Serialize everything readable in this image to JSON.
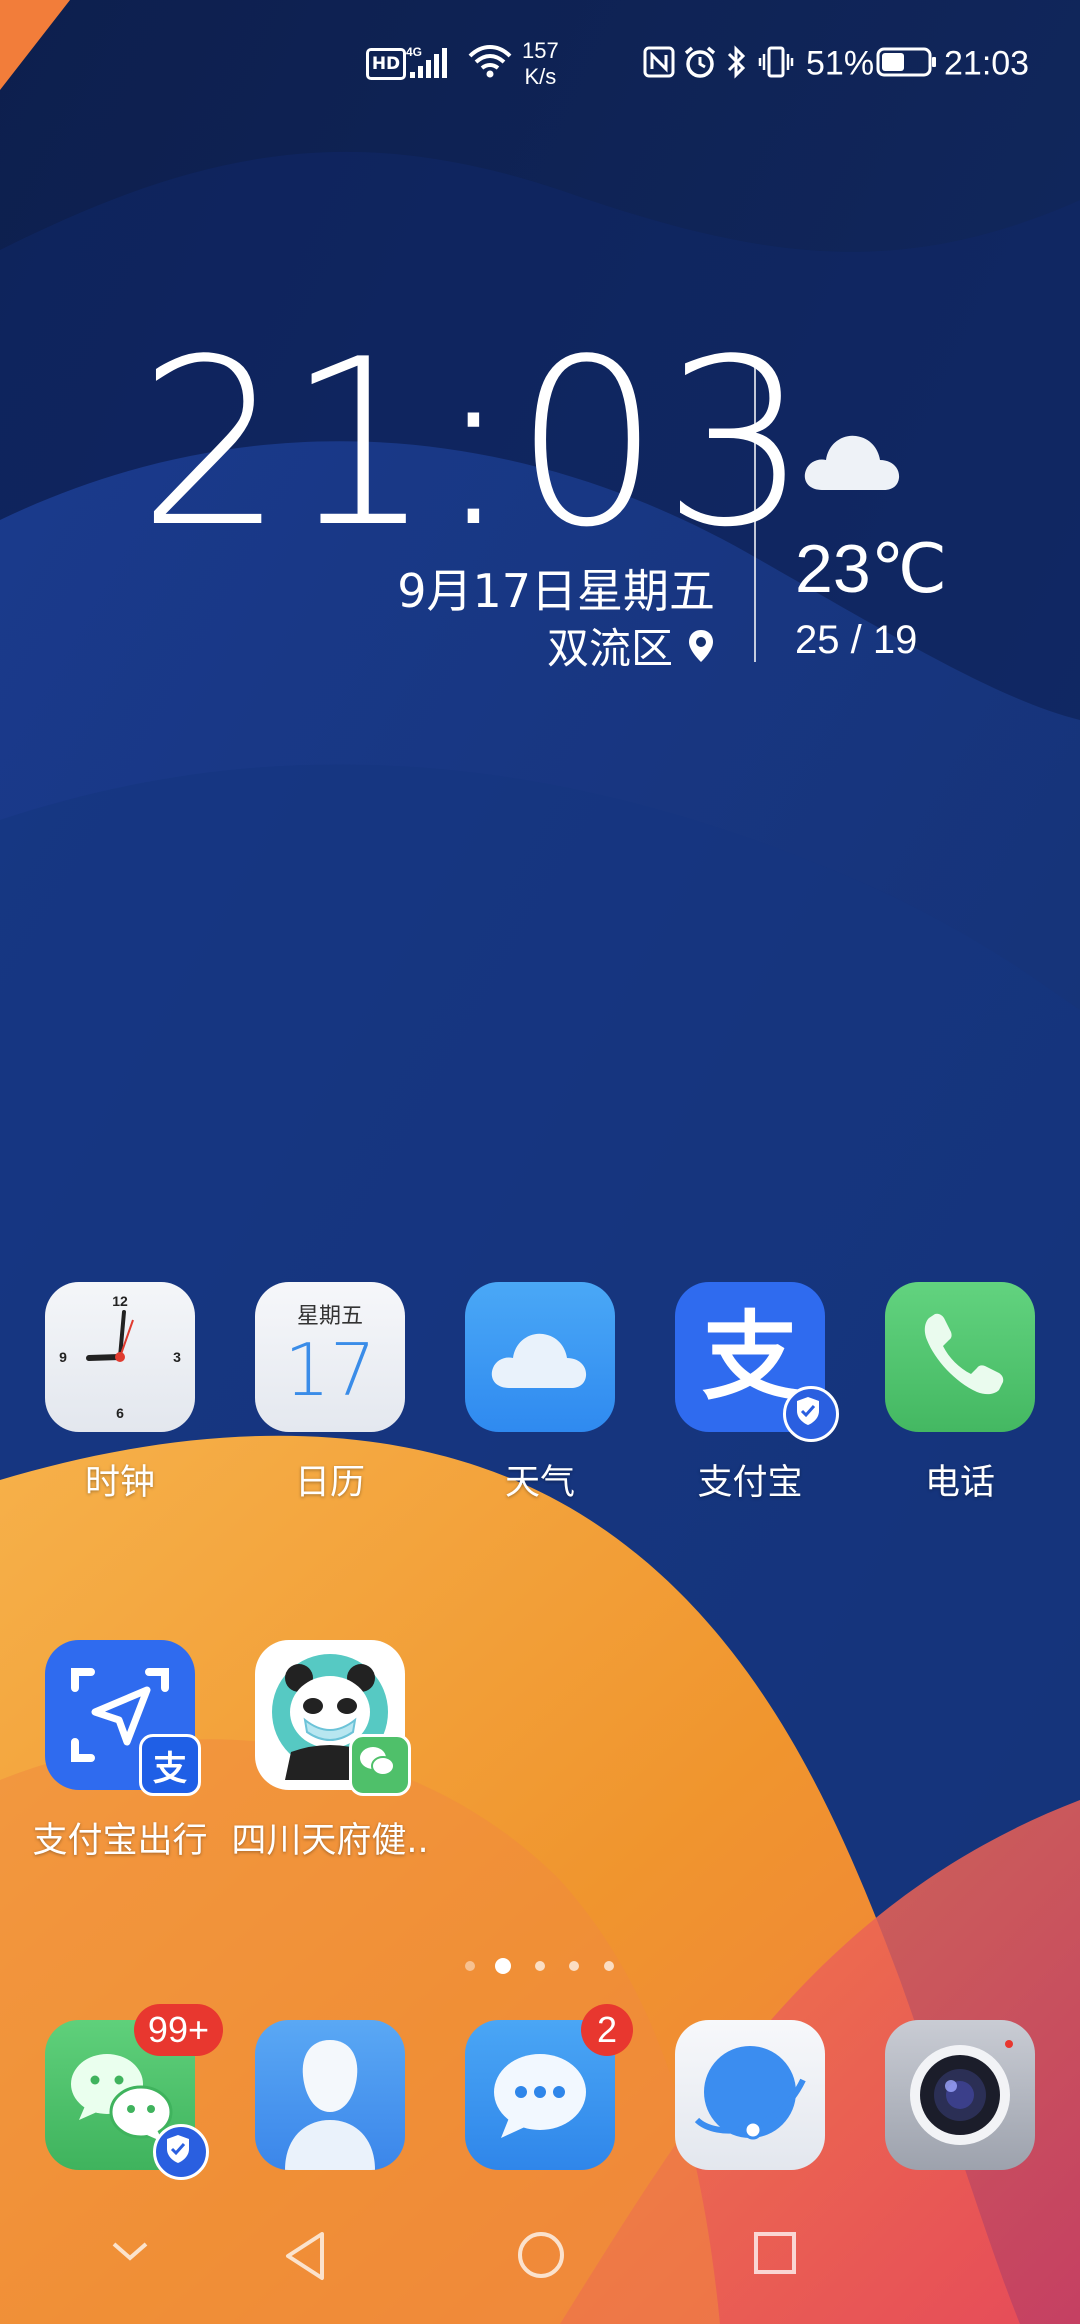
{
  "status_bar": {
    "hd_label": "HD",
    "network_label": "4G",
    "speed_value": "157",
    "speed_unit": "K/s",
    "battery_percent": "51%",
    "time": "21:03",
    "battery_level": 0.51,
    "icons": [
      "nfc-icon",
      "alarm-icon",
      "bluetooth-icon",
      "vibrate-icon",
      "battery-icon"
    ]
  },
  "clock_widget": {
    "time": "21:03",
    "date": "9月17日星期五",
    "location": "双流区",
    "weather_icon": "cloud-icon",
    "temperature": "23℃",
    "temp_range": "25 / 19"
  },
  "apps_row1": [
    {
      "label": "时钟",
      "icon": "clock-icon"
    },
    {
      "label": "日历",
      "icon": "calendar-icon",
      "weekday": "星期五",
      "day": "17"
    },
    {
      "label": "天气",
      "icon": "weather-icon"
    },
    {
      "label": "支付宝",
      "icon": "alipay-icon",
      "glyph": "支"
    },
    {
      "label": "电话",
      "icon": "phone-icon"
    }
  ],
  "apps_row2": [
    {
      "label": "支付宝出行",
      "icon": "alipay-travel-icon",
      "glyph": "支"
    },
    {
      "label": "四川天府健..",
      "icon": "tianfu-health-icon"
    }
  ],
  "dock": [
    {
      "name": "wechat",
      "icon": "wechat-icon",
      "badge": "99+"
    },
    {
      "name": "contacts",
      "icon": "contacts-icon"
    },
    {
      "name": "messages",
      "icon": "messages-icon",
      "badge": "2"
    },
    {
      "name": "browser",
      "icon": "browser-icon"
    },
    {
      "name": "camera",
      "icon": "camera-icon"
    }
  ],
  "page_indicator": {
    "pages": 5,
    "current": 2
  },
  "nav_bar": [
    "collapse-icon",
    "back-icon",
    "home-icon",
    "recents-icon"
  ],
  "colors": {
    "wallpaper_navy": "#0f2356",
    "wallpaper_blue": "#1c3d8e",
    "wallpaper_orange": "#f3a23a",
    "wallpaper_pink": "#e85a6a",
    "badge_red": "#e8372f",
    "alipay_blue": "#2f6bef",
    "wechat_green": "#4fc06a"
  }
}
